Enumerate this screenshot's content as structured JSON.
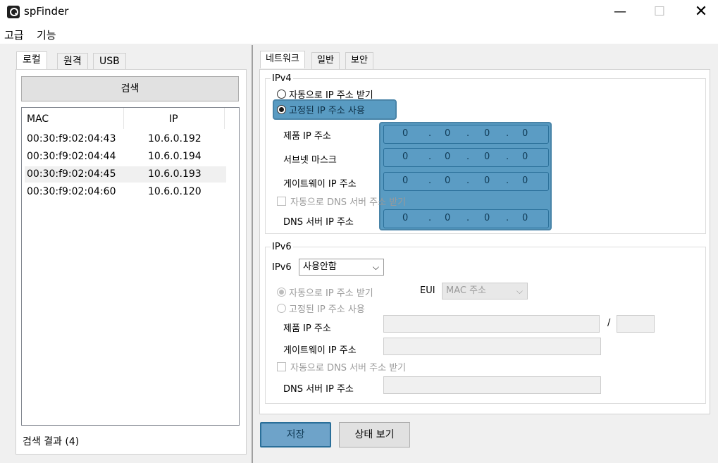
{
  "window": {
    "title": "spFinder",
    "minimize": "—",
    "maximize": "☐",
    "close": "✕"
  },
  "menu": [
    {
      "label": "고급"
    },
    {
      "label": "기능"
    }
  ],
  "left": {
    "tabs": [
      {
        "label": "로컬"
      },
      {
        "label": "원격"
      },
      {
        "label": "USB"
      }
    ],
    "search_label": "검색",
    "columns": {
      "mac": "MAC",
      "ip": "IP"
    },
    "rows": [
      {
        "mac": "00:30:f9:02:04:43",
        "ip": "10.6.0.192"
      },
      {
        "mac": "00:30:f9:02:04:44",
        "ip": "10.6.0.194"
      },
      {
        "mac": "00:30:f9:02:04:45",
        "ip": "10.6.0.193"
      },
      {
        "mac": "00:30:f9:02:04:60",
        "ip": "10.6.0.120"
      }
    ],
    "status": "검색 결과 (4)"
  },
  "right": {
    "tabs": [
      {
        "label": "네트워크"
      },
      {
        "label": "일반"
      },
      {
        "label": "보안"
      }
    ],
    "ipv4": {
      "title": "IPv4",
      "auto_ip_label": "자동으로 IP 주소 받기",
      "static_ip_label": "고정된 IP 주소 사용",
      "product_ip_label": "제품 IP 주소",
      "subnet_label": "서브넷 마스크",
      "gateway_label": "게이트웨이 IP 주소",
      "auto_dns_label": "자동으로 DNS 서버 주소 받기",
      "dns_label": "DNS 서버 IP 주소",
      "octet": "0",
      "dot": "."
    },
    "ipv6": {
      "title": "IPv6",
      "mode_label": "IPv6",
      "mode_value": "사용안함",
      "auto_ip_label": "자동으로 IP 주소 받기",
      "eui_label": "EUI",
      "eui_value": "MAC 주소",
      "static_ip_label": "고정된 IP 주소 사용",
      "product_ip_label": "제품 IP 주소",
      "prefix_sep": "/",
      "gateway_label": "게이트웨이 IP 주소",
      "auto_dns_label": "자동으로 DNS 서버 주소 받기",
      "dns_label": "DNS 서버 IP 주소"
    },
    "save_label": "저장",
    "status_label": "상태 보기"
  },
  "chevron": "⌵"
}
